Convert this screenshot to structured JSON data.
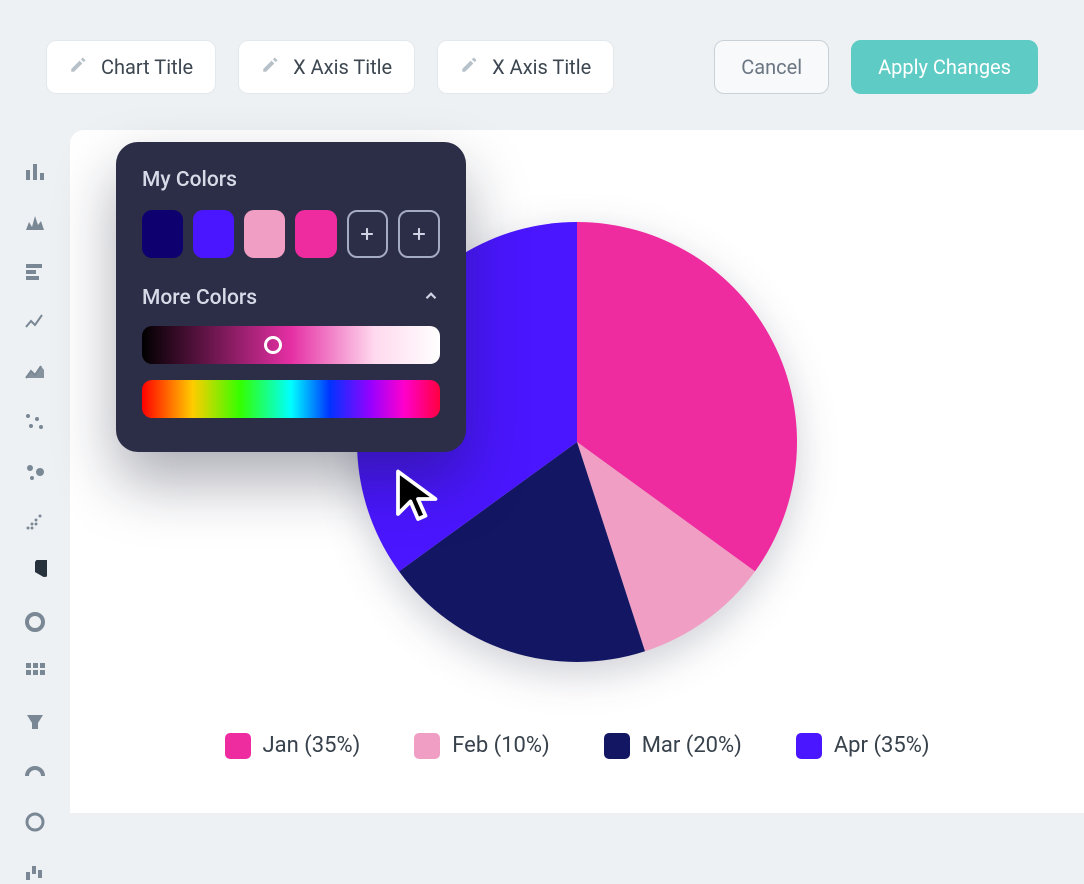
{
  "toolbar": {
    "field1": "Chart Title",
    "field2": "X Axis Title",
    "field3": "X Axis Title",
    "cancel": "Cancel",
    "apply": "Apply Changes"
  },
  "picker": {
    "my_colors_label": "My Colors",
    "more_colors_label": "More Colors",
    "swatches": [
      "#0e006e",
      "#4a16ff",
      "#f09ec3",
      "#ef2ba0"
    ]
  },
  "chart_data": {
    "type": "pie",
    "title": "",
    "series": [
      {
        "name": "Jan",
        "value": 35,
        "color": "#ef2ba0"
      },
      {
        "name": "Feb",
        "value": 10,
        "color": "#f09ec3"
      },
      {
        "name": "Mar",
        "value": 20,
        "color": "#131663"
      },
      {
        "name": "Apr",
        "value": 35,
        "color": "#4a16ff"
      }
    ],
    "legend": [
      {
        "label": "Jan (35%)",
        "color": "#ef2ba0"
      },
      {
        "label": "Feb (10%)",
        "color": "#f09ec3"
      },
      {
        "label": "Mar (20%)",
        "color": "#131663"
      },
      {
        "label": "Apr (35%)",
        "color": "#4a16ff"
      }
    ]
  }
}
